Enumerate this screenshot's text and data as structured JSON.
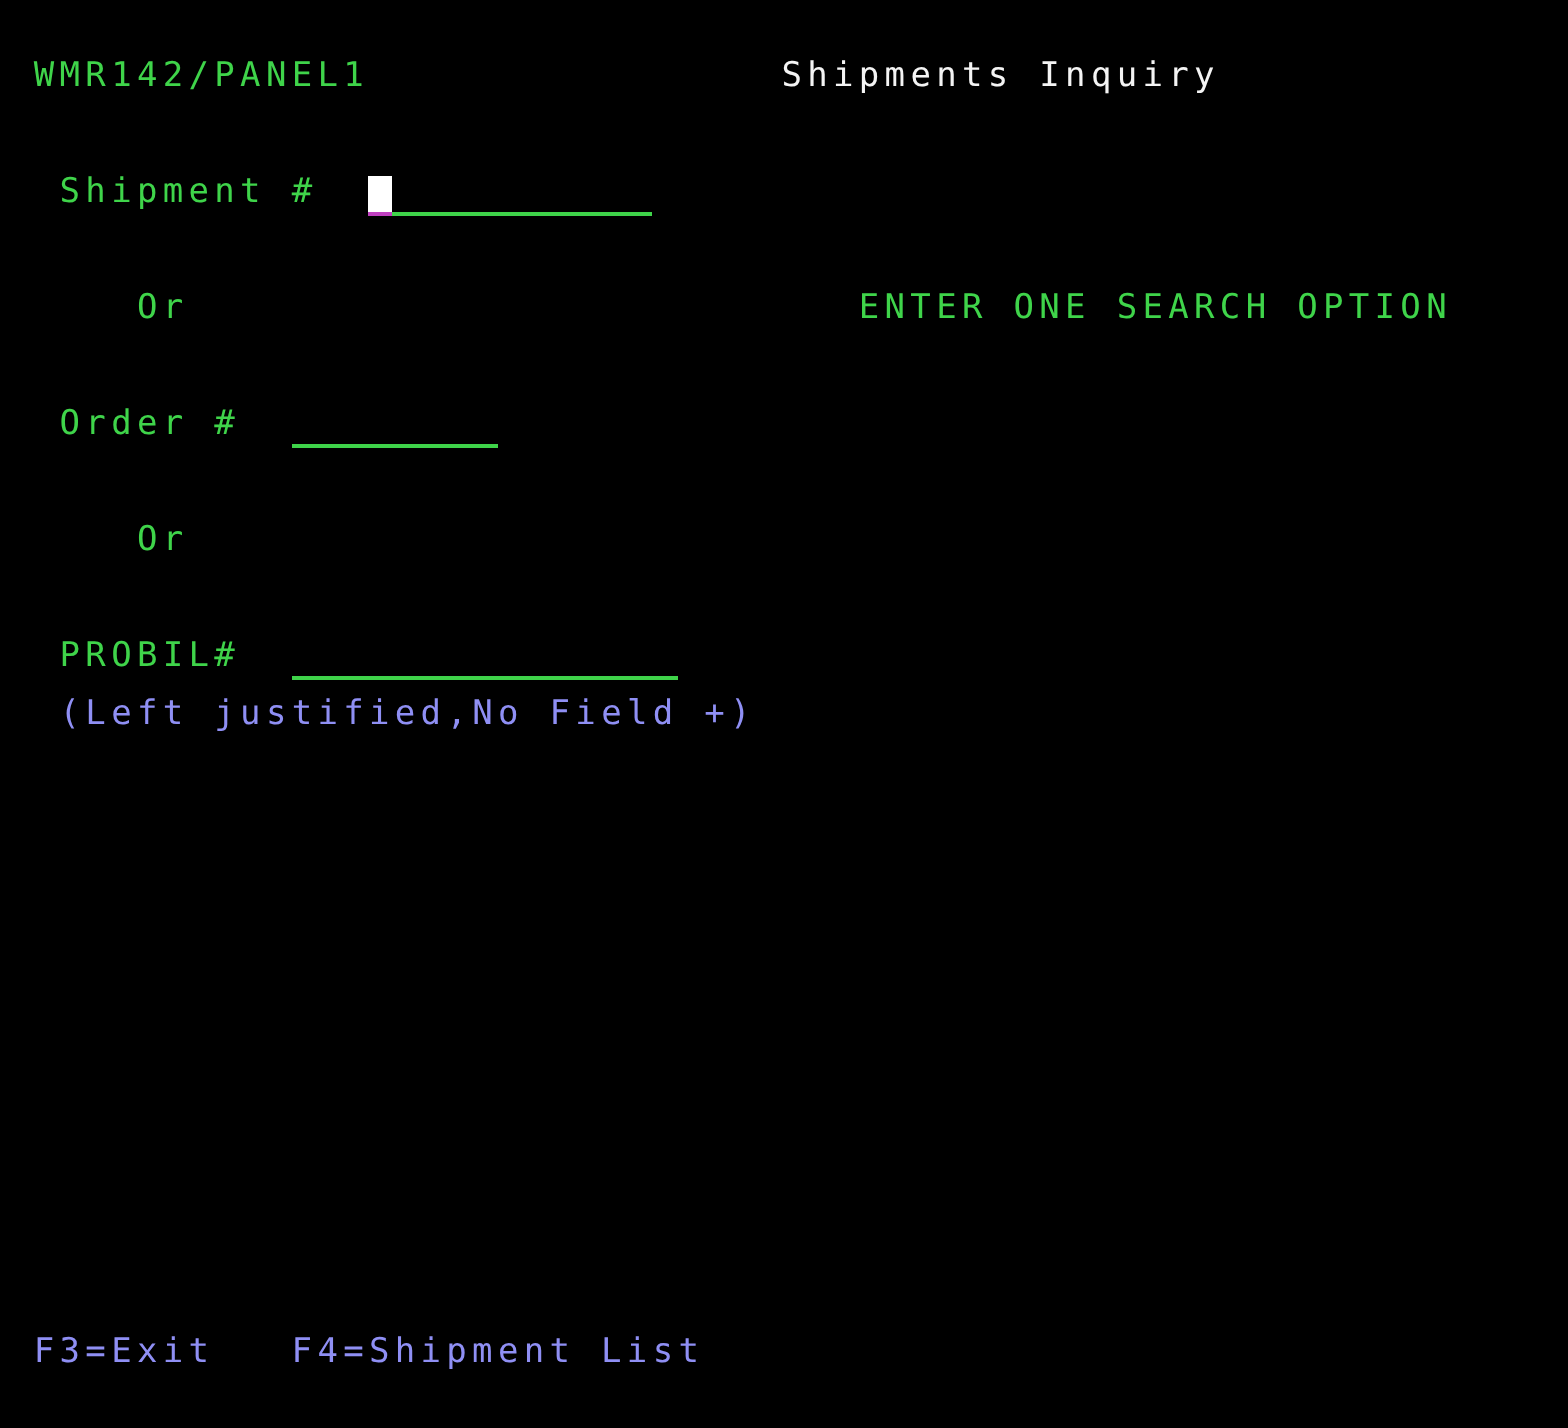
{
  "header": {
    "program": "WMR142/PANEL1",
    "title": "Shipments Inquiry"
  },
  "fields": [
    {
      "label": "Shipment #",
      "focused": true
    },
    {
      "label": "Order #",
      "focused": false
    },
    {
      "label": "PROBIL#",
      "focused": false
    }
  ],
  "separators": [
    "Or",
    "Or"
  ],
  "message": "ENTER ONE SEARCH OPTION",
  "hint": "(Left justified,No Field +)",
  "function_keys": [
    "F3=Exit",
    "F4=Shipment List"
  ]
}
